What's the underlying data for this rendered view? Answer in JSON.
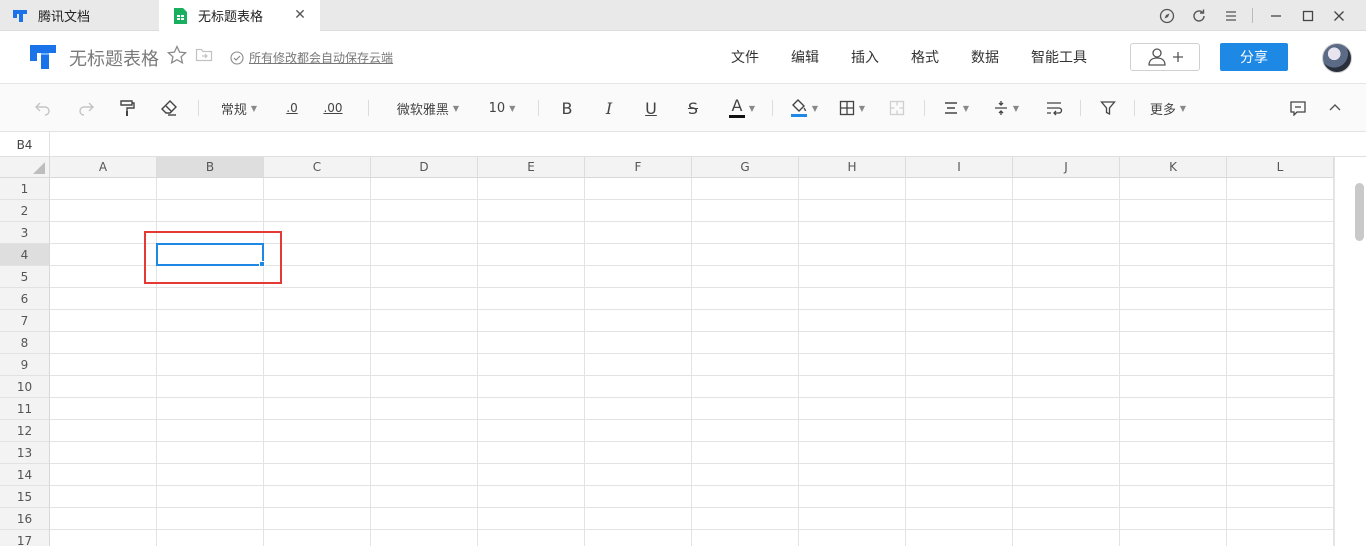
{
  "titlebar": {
    "tabs": [
      {
        "label": "腾讯文档"
      },
      {
        "label": "无标题表格"
      }
    ]
  },
  "header": {
    "doc_title": "无标题表格",
    "save_status": "所有修改都会自动保存云端",
    "menus": [
      "文件",
      "编辑",
      "插入",
      "格式",
      "数据",
      "智能工具"
    ],
    "share_label": "分享"
  },
  "toolbar": {
    "number_format": "常规",
    "decimal_decrease": ".0",
    "decimal_increase": ".00",
    "font_family": "微软雅黑",
    "font_size": "10",
    "bold": "B",
    "italic": "I",
    "underline": "U",
    "strike": "S",
    "font_color_glyph": "A",
    "more_label": "更多"
  },
  "formula_bar": {
    "cell_ref": "B4"
  },
  "grid": {
    "columns": [
      "A",
      "B",
      "C",
      "D",
      "E",
      "F",
      "G",
      "H",
      "I",
      "J",
      "K",
      "L"
    ],
    "rows": [
      "1",
      "2",
      "3",
      "4",
      "5",
      "6",
      "7",
      "8",
      "9",
      "10",
      "11",
      "12",
      "13",
      "14",
      "15",
      "16",
      "17"
    ],
    "selected_cell": "B4"
  },
  "colors": {
    "accent": "#1e88e5",
    "brand_blue": "#1a73e8",
    "sheet_green": "#1aae5f",
    "highlight_red": "#e53935"
  }
}
